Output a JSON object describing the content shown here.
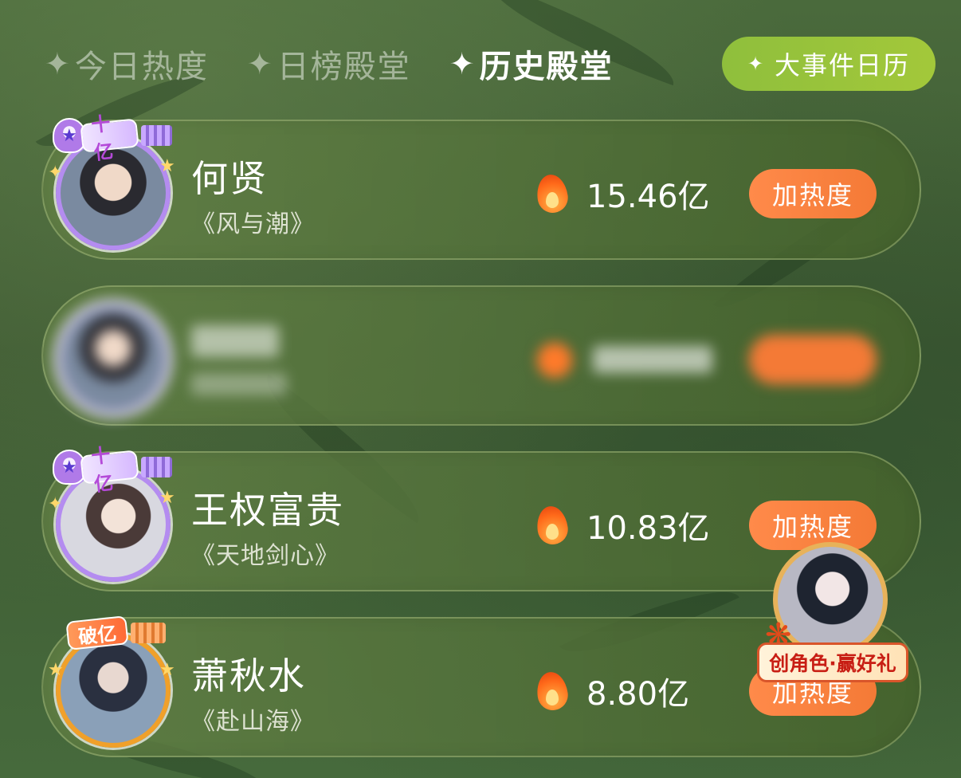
{
  "tabs": [
    {
      "label": "今日热度",
      "active": false
    },
    {
      "label": "日榜殿堂",
      "active": false
    },
    {
      "label": "历史殿堂",
      "active": true
    }
  ],
  "event_calendar_label": "大事件日历",
  "rankings": [
    {
      "name": "何贤",
      "drama": "《风与潮》",
      "heat": "15.46亿",
      "badge": "十亿",
      "button": "加热度"
    },
    {
      "name": "",
      "drama": "",
      "heat": "",
      "badge": "",
      "button": "",
      "blurred": true
    },
    {
      "name": "王权富贵",
      "drama": "《天地剑心》",
      "heat": "10.83亿",
      "badge": "十亿",
      "button": "加热度"
    },
    {
      "name": "萧秋水",
      "drama": "《赴山海》",
      "heat": "8.80亿",
      "badge": "破亿",
      "button": "加热度"
    }
  ],
  "promo": {
    "label": "创角色·赢好礼"
  },
  "colors": {
    "accent_orange": "#f47a36",
    "calendar_green": "#a3c83a",
    "badge_purple": "#b48cf0",
    "badge_gold": "#f0a02a"
  },
  "icons": [
    "sparkle-icon",
    "flame-icon",
    "trophy-icon",
    "maple-leaf-icon"
  ]
}
